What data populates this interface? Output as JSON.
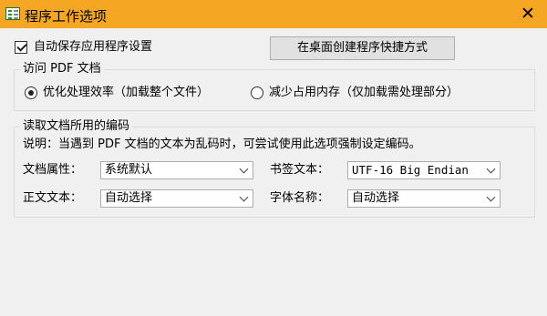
{
  "window": {
    "title": "程序工作选项",
    "close_glyph": "✕"
  },
  "autosave": {
    "label": "自动保存应用程序设置",
    "checked": true
  },
  "shortcut_button": "在桌面创建程序快捷方式",
  "pdf_access": {
    "group_title": "访问 PDF 文档",
    "options": [
      {
        "label": "优化处理效率（加载整个文件）",
        "checked": true
      },
      {
        "label": "减少占用内存（仅加载需处理部分）",
        "checked": false
      }
    ]
  },
  "encoding": {
    "group_title": "读取文档所用的编码",
    "description": "说明：当遇到 PDF 文档的文本为乱码时，可尝试使用此选项强制设定编码。",
    "fields": {
      "doc_props": {
        "label": "文档属性：",
        "value": "系统默认"
      },
      "bookmark": {
        "label": "书签文本：",
        "value": "UTF-16 Big Endian"
      },
      "body_text": {
        "label": "正文文本：",
        "value": "自动选择"
      },
      "font_name": {
        "label": "字体名称：",
        "value": "自动选择"
      }
    }
  }
}
